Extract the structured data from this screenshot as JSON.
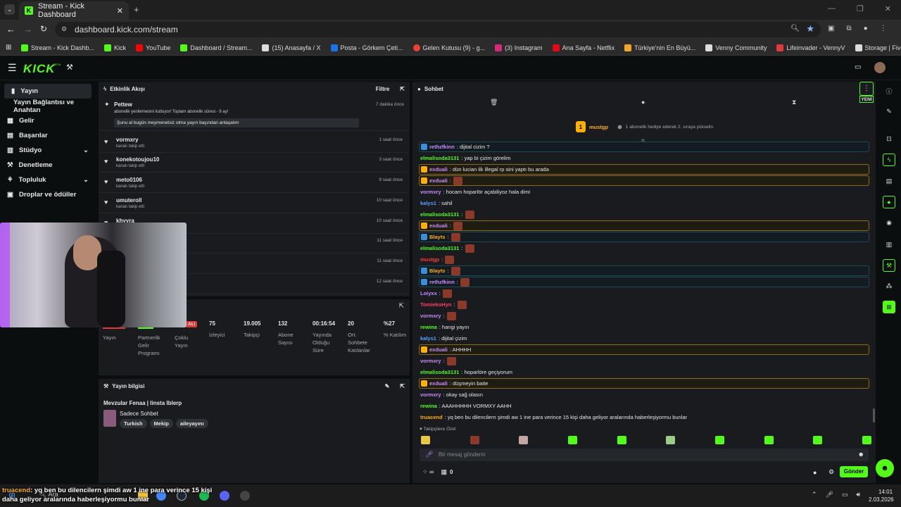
{
  "browser": {
    "tab_title": "Stream - Kick Dashboard",
    "url": "dashboard.kick.com/stream",
    "bookmarks": [
      "Stream - Kick Dashb...",
      "Kick",
      "YouTube",
      "Dashboard / Stream...",
      "(15) Anasayfa / X",
      "Posta - Görkem Çeti...",
      "Gelen Kutusu (9) - g...",
      "(3) Instagram",
      "Ana Sayfa - Netflix",
      "Türkiye'nin En Büyü...",
      "Venny Community",
      "Lifeinvader - VennyV",
      "Storage | Fivemanage"
    ]
  },
  "header": {
    "logo": "KICK",
    "beta": "BETA"
  },
  "sidebar": {
    "items": [
      {
        "label": "Yayın",
        "icon": "broadcast-icon"
      },
      {
        "label": "Yayın Bağlantısı ve Anahtarı"
      },
      {
        "label": "Gelir"
      },
      {
        "label": "Başarılar"
      },
      {
        "label": "Stüdyo"
      },
      {
        "label": "Denetleme"
      },
      {
        "label": "Topluluk"
      },
      {
        "label": "Droplar ve ödüller"
      }
    ]
  },
  "activity": {
    "title": "Etkinlik Akışı",
    "filter": "Filtre",
    "first": {
      "name": "Pettew",
      "text": "abonelik yenilemesini kutluyor! Toplam abonelik süresi - 9 ay!",
      "time": "7 dakika önce",
      "message": "Şunu al bugün meymenetsiz olma yayın başından anlaşalım"
    },
    "items": [
      {
        "name": "vormxry",
        "sub": "kanalı takip etti",
        "time": "1 saat önce"
      },
      {
        "name": "konekotoujou10",
        "sub": "kanalı takip etti",
        "time": "3 saat önce"
      },
      {
        "name": "meto0106",
        "sub": "kanalı takip etti",
        "time": "9 saat önce"
      },
      {
        "name": "umuteroll",
        "sub": "kanalı takip etti",
        "time": "10 saat önce"
      },
      {
        "name": "khyyra",
        "sub": "",
        "time": "10 saat önce"
      },
      {
        "name": "",
        "sub": "",
        "time": "11 saat önce"
      },
      {
        "name": "",
        "sub": "",
        "time": "11 saat önce"
      },
      {
        "name": "",
        "sub": "",
        "time": "12 saat önce"
      }
    ]
  },
  "stats": {
    "live_badge": "ALI",
    "items": [
      {
        "label": "Yayın",
        "value": ""
      },
      {
        "label": "Partnerlik Gelir Programı",
        "value": ""
      },
      {
        "label": "Çoklu Yayın",
        "value": ""
      },
      {
        "label": "İzleyici",
        "value": "75"
      },
      {
        "label": "Takipçi",
        "value": "19.005"
      },
      {
        "label": "Abone Sayısı",
        "value": "132"
      },
      {
        "label": "Yayında Olduğu Süre",
        "value": "00:16:54"
      },
      {
        "label": "Ort. Sohbete Katılanlar",
        "value": "20"
      },
      {
        "label": "% Katılım",
        "value": "%27"
      }
    ]
  },
  "stream_info": {
    "title": "Yayın bilgisi",
    "stream_title": "Mevzular Fenaa | Iinsta Iblerp",
    "category": "Sadece Sohbet",
    "tags": [
      "Turkish",
      "Mekip",
      "aileyayını"
    ]
  },
  "chat": {
    "title": "Sohbet",
    "new_label": "YENİ",
    "pinned_user": "mustgp",
    "pinned_rank": "1",
    "promo": "1 abonelik hediye ederek 2. sıraya yükselin",
    "messages": [
      {
        "user": "rethzfkinn",
        "text": ": dijital cizim ?",
        "color": "#c88bff",
        "style": "bl"
      },
      {
        "user": "elmalisoda3131",
        "text": ": yap bi çizim görelim",
        "color": "#53fc18",
        "style": ""
      },
      {
        "user": "exduali",
        "text": ": dün lucian ilk illegal rp sini yaptı bu arada",
        "color": "#c88bff",
        "style": "hl"
      },
      {
        "user": "exduali",
        "text": ":",
        "color": "#c88bff",
        "style": "hl",
        "emote": true
      },
      {
        "user": "vormxry",
        "text": ": hocam hoparlör açabiliyoz hala dimi",
        "color": "#c88bff",
        "style": ""
      },
      {
        "user": "kalys1",
        "text": ": sahil",
        "color": "#5aa0ff",
        "style": ""
      },
      {
        "user": "elmalisoda3131",
        "text": ":",
        "color": "#53fc18",
        "style": "",
        "emote": true
      },
      {
        "user": "exduali",
        "text": ":",
        "color": "#c88bff",
        "style": "hl",
        "emote": true
      },
      {
        "user": "Blayts",
        "text": ":",
        "color": "#ffb000",
        "style": "bl",
        "emote": true
      },
      {
        "user": "elmalisoda3131",
        "text": ":",
        "color": "#53fc18",
        "style": "",
        "emote": true
      },
      {
        "user": "mustgp",
        "text": ":",
        "color": "#ff3b3b",
        "style": "",
        "emote": true
      },
      {
        "user": "Blayts",
        "text": ":",
        "color": "#ffb000",
        "style": "bl",
        "emote": true
      },
      {
        "user": "rethzfkinn",
        "text": ":",
        "color": "#c88bff",
        "style": "bl",
        "emote": true
      },
      {
        "user": "Loiyxx",
        "text": ":",
        "color": "#c88bff",
        "style": "",
        "emote": true
      },
      {
        "user": "TomiekoHyn",
        "text": ":",
        "color": "#ff3b6b",
        "style": "",
        "emote": true
      },
      {
        "user": "vormxry",
        "text": ":",
        "color": "#c88bff",
        "style": "",
        "emote": true
      },
      {
        "user": "rewina",
        "text": ": hangi yayın",
        "color": "#53fc18",
        "style": ""
      },
      {
        "user": "kalys1",
        "text": ": dijital çizim",
        "color": "#5aa0ff",
        "style": ""
      },
      {
        "user": "exduali",
        "text": ": AHHHH",
        "color": "#c88bff",
        "style": "hl"
      },
      {
        "user": "vormxry",
        "text": ":",
        "color": "#c88bff",
        "style": "",
        "emote": true
      },
      {
        "user": "elmalisoda3131",
        "text": ": hoparlöre geçiyorum",
        "color": "#53fc18",
        "style": ""
      },
      {
        "user": "exduali",
        "text": ": düşmeyin baite",
        "color": "#c88bff",
        "style": "hl"
      },
      {
        "user": "vormxry",
        "text": ": okay sağ olasın",
        "color": "#c88bff",
        "style": ""
      },
      {
        "user": "rewina",
        "text": ": AAAHHHHH VORMXY AAHH",
        "color": "#53fc18",
        "style": ""
      },
      {
        "user": "truacend",
        "text": ": yq ben bu dilencilern şimdi aw 1 ine para verince 15 kişi daha geliyor aralarında haberleşiyormu bunlar",
        "color": "#ffb000",
        "style": ""
      }
    ],
    "emote_row_label": "Takipçilere Özel",
    "input_placeholder": "Bir mesaj gönderin",
    "send": "Gönder",
    "points": "0"
  },
  "overlay_caption": {
    "user": "truacend",
    "text": ": yq ben bu dilencilern şimdi aw 1 ine para verince 15 kişi daha geliyor aralarında haberleşiyormu bunlar"
  },
  "taskbar": {
    "search": "Ara",
    "time": "14:01",
    "date": "2.03.2026"
  },
  "colors": {
    "accent": "#53fc18"
  }
}
